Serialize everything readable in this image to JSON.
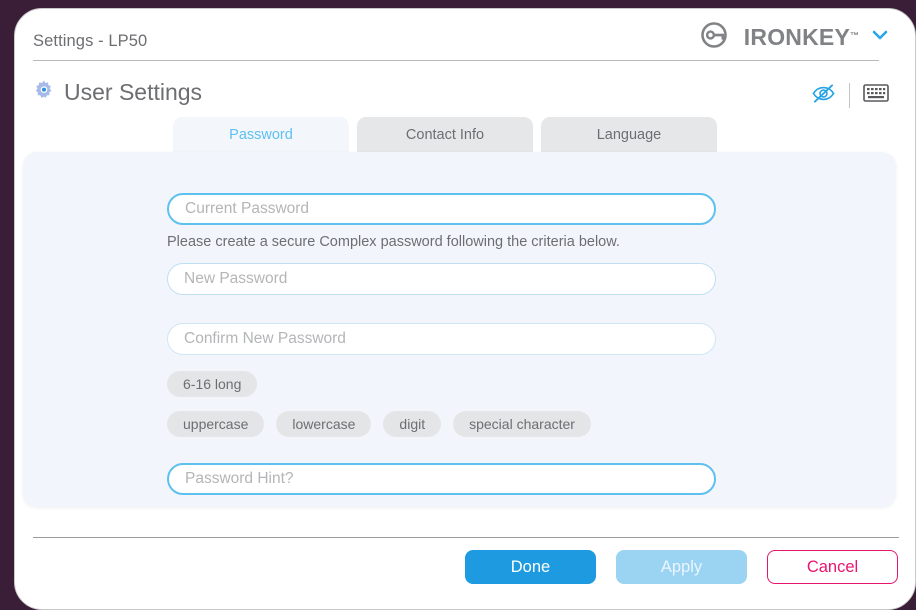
{
  "window": {
    "title": "Settings - LP50",
    "brand_name": "IRONKEY",
    "brand_tm": "™",
    "brand_caret_icon": "chevron-down-icon",
    "brand_logo_icon": "ironkey-circle-key-logo"
  },
  "section": {
    "title": "User Settings",
    "gear_icon": "gear-icon",
    "tools": [
      {
        "name": "eye-slash-icon",
        "label": "Hide password"
      },
      {
        "name": "keyboard-icon",
        "label": "Virtual keyboard"
      }
    ]
  },
  "tabs": [
    {
      "label": "Password",
      "active": true
    },
    {
      "label": "Contact Info",
      "active": false
    },
    {
      "label": "Language",
      "active": false
    }
  ],
  "form": {
    "current_password": {
      "placeholder": "Current Password",
      "value": ""
    },
    "helper_text": "Please create a secure Complex password following the criteria below.",
    "new_password": {
      "placeholder": "New Password",
      "value": ""
    },
    "confirm_password": {
      "placeholder": "Confirm New Password",
      "value": ""
    },
    "hint": {
      "placeholder": "Password Hint?",
      "value": ""
    },
    "criteria_row1": [
      "6-16 long"
    ],
    "criteria_row2": [
      "uppercase",
      "lowercase",
      "digit",
      "special character"
    ]
  },
  "footer": {
    "done_label": "Done",
    "apply_label": "Apply",
    "cancel_label": "Cancel"
  },
  "colors": {
    "accent_blue": "#1e9be0",
    "tab_blue": "#5ec0ef",
    "disabled_blue": "#9bd3f2",
    "danger_pink": "#e8156e",
    "panel_bg": "#f2f6fc",
    "text_gray": "#6d6e71",
    "desktop_bg": "#3a1d36"
  }
}
